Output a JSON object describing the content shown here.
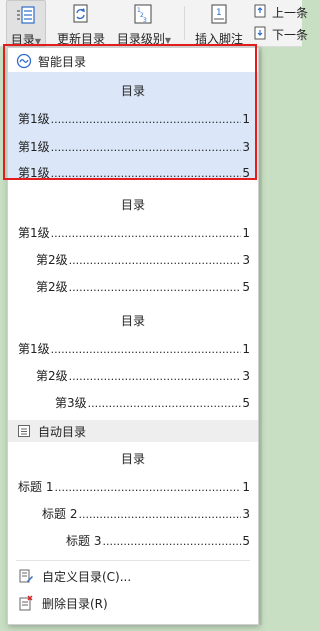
{
  "ribbon": {
    "toc_label": "目录",
    "update_label": "更新目录",
    "level_label": "目录级别",
    "footnote_label": "插入脚注",
    "prev_label": "上一条",
    "next_label": "下一条"
  },
  "smart_toc": {
    "header": "智能目录",
    "title": "目录",
    "lines": [
      {
        "label": "第1级",
        "page": "1"
      },
      {
        "label": "第1级",
        "page": "3"
      },
      {
        "label": "第1级",
        "page": "5"
      }
    ]
  },
  "toc_style_2": {
    "title": "目录",
    "lines": [
      {
        "label": "第1级",
        "page": "1"
      },
      {
        "label": "第2级",
        "page": "3"
      },
      {
        "label": "第2级",
        "page": "5"
      }
    ]
  },
  "toc_style_3": {
    "title": "目录",
    "lines": [
      {
        "label": "第1级",
        "page": "1"
      },
      {
        "label": "第2级",
        "page": "3"
      },
      {
        "label": "第3级",
        "page": "5"
      }
    ]
  },
  "auto_toc": {
    "header": "自动目录",
    "title": "目录",
    "lines": [
      {
        "label": "标题 1",
        "page": "1"
      },
      {
        "label": "标题 2",
        "page": "3"
      },
      {
        "label": "标题 3",
        "page": "5"
      }
    ]
  },
  "menu": {
    "custom_label": "自定义目录(C)...",
    "delete_label": "删除目录(R)"
  },
  "colors": {
    "highlight": "#dbe7f8",
    "red_outline": "#e21d1d",
    "icon_blue": "#2f6cc9"
  }
}
